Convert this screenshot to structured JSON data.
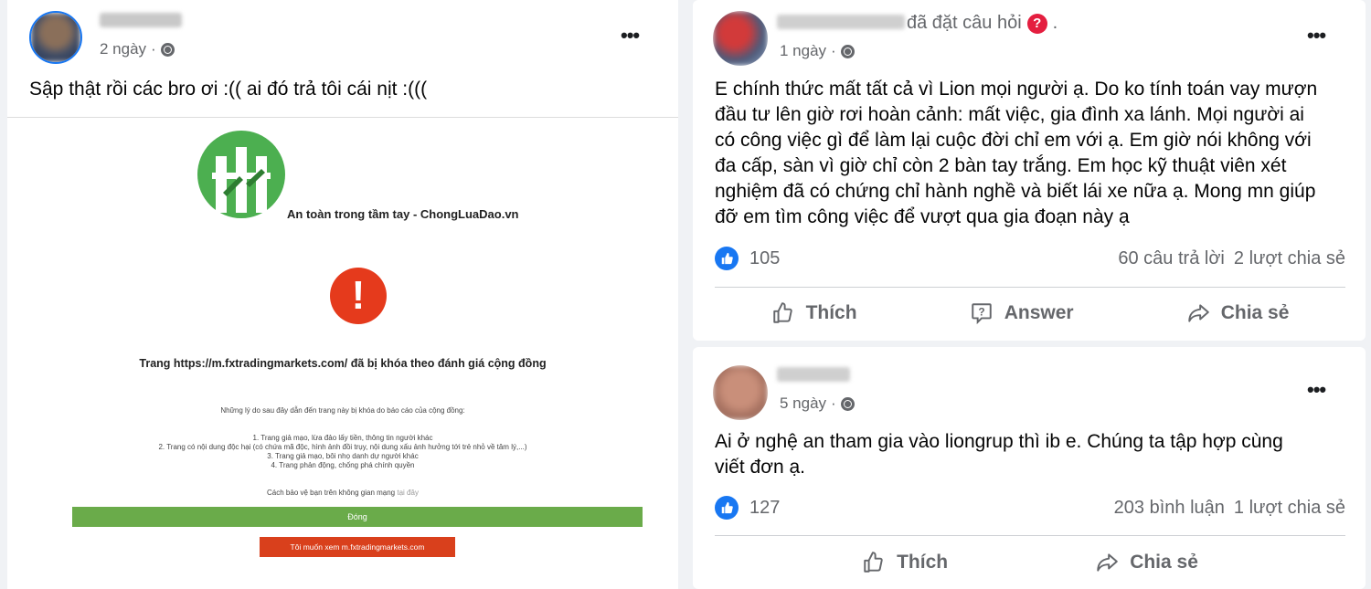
{
  "post1": {
    "time": "2 ngày",
    "text": "Sập thật rồi các bro ơi :(( ai đó trả tôi cái nịt :(((",
    "more": "•••",
    "embed": {
      "slogan": "An toàn trong tầm tay - ChongLuaDao.vn",
      "alert_mark": "!",
      "blocked_title": "Trang https://m.fxtradingmarkets.com/ đã bị khóa theo đánh giá cộng đồng",
      "reasons_intro": "Những lý do sau đây dẫn đến trang này bị khóa do báo cáo của cộng đồng:",
      "reasons": [
        "1. Trang giả mạo, lừa đảo lấy tiền, thông tin người khác",
        "2. Trang có nội dung độc hại (có chứa mã độc, hình ảnh đồi trụy, nội dung xấu ảnh hưởng tới trẻ nhỏ về tâm lý,...)",
        "3. Trang giả mạo, bôi nhọ danh dự người khác",
        "4. Trang phản động, chống phá chính quyền"
      ],
      "protect_text": "Cách bảo vệ bạn trên không gian mạng",
      "protect_link": "tại đây",
      "close_button": "Đóng",
      "view_button": "Tôi muốn xem m.fxtradingmarkets.com"
    }
  },
  "post2": {
    "asked": "đã đặt câu hỏi",
    "asked_badge": "?",
    "asked_dot": ".",
    "time": "1 ngày",
    "more": "•••",
    "text_lines": [
      "E chính thức mất tất cả vì Lion mọi người ạ. Do ko tính toán vay mượn",
      "đầu tư lên giờ rơi hoàn cảnh: mất việc, gia đình xa lánh. Mọi người ai",
      "có công việc gì để làm lại cuộc đời chỉ em với ạ. Em giờ nói không với",
      "đa cấp, sàn vì giờ chỉ còn 2 bàn tay trắng. Em học kỹ thuật viên xét",
      "nghiệm đã có chứng chỉ hành nghề và biết lái xe nữa ạ. Mong mn giúp",
      "đỡ em tìm công việc để vượt qua gia đoạn này ạ"
    ],
    "likes": "105",
    "answers": "60 câu trả lời",
    "shares": "2 lượt chia sẻ",
    "action_like": "Thích",
    "action_answer": "Answer",
    "action_share": "Chia sẻ"
  },
  "post3": {
    "time": "5 ngày",
    "more": "•••",
    "text_lines": [
      "Ai ở nghệ an tham gia vào liongrup thì ib e. Chúng ta tập hợp cùng",
      "viết đơn ạ."
    ],
    "likes": "127",
    "comments": "203 bình luận",
    "shares": "1 lượt chia sẻ",
    "action_like": "Thích",
    "action_share": "Chia sẻ"
  },
  "colors": {
    "facebook_blue": "#1877f2",
    "green_logo": "#4caf50",
    "alert_red": "#e53a1c",
    "close_green": "#6aab4a",
    "view_red": "#d9401c"
  }
}
